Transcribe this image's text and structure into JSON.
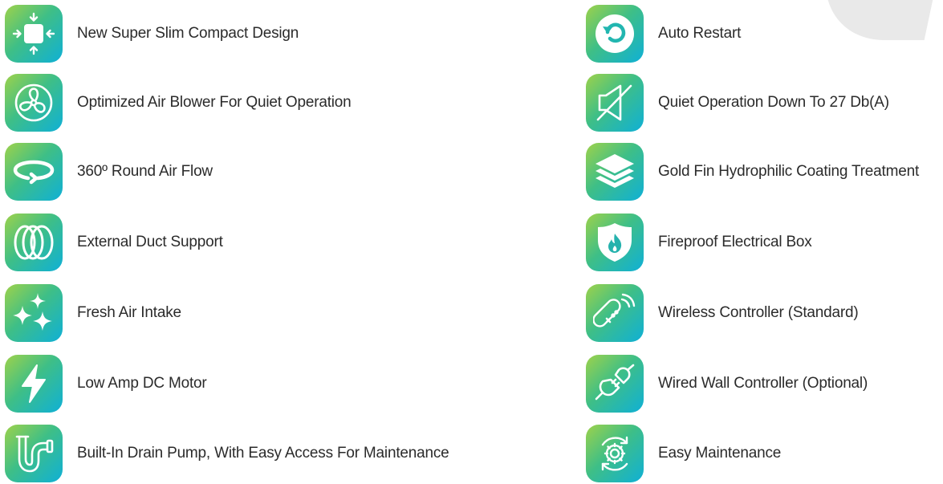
{
  "features_left": [
    {
      "icon": "compact-design-icon",
      "label": "New Super Slim Compact Design"
    },
    {
      "icon": "fan-blower-icon",
      "label": "Optimized Air Blower For Quiet Operation"
    },
    {
      "icon": "round-air-flow-icon",
      "label": "360º Round Air Flow"
    },
    {
      "icon": "duct-rings-icon",
      "label": "External Duct Support"
    },
    {
      "icon": "sparkles-icon",
      "label": "Fresh Air Intake"
    },
    {
      "icon": "lightning-bolt-icon",
      "label": "Low Amp DC Motor"
    },
    {
      "icon": "drain-pipe-icon",
      "label": "Built-In Drain Pump, With Easy Access For Maintenance"
    }
  ],
  "features_right": [
    {
      "icon": "auto-restart-icon",
      "label": "Auto Restart"
    },
    {
      "icon": "mute-speaker-icon",
      "label": "Quiet Operation Down To 27 Db(A)"
    },
    {
      "icon": "layers-icon",
      "label": "Gold Fin Hydrophilic Coating Treatment"
    },
    {
      "icon": "fire-shield-icon",
      "label": "Fireproof Electrical Box"
    },
    {
      "icon": "wireless-remote-icon",
      "label": "Wireless Controller (Standard)"
    },
    {
      "icon": "plug-icon",
      "label": "Wired Wall Controller (Optional)"
    },
    {
      "icon": "gear-maintenance-icon",
      "label": "Easy Maintenance"
    }
  ],
  "colors": {
    "tile_gradient_start": "#9ed24a",
    "tile_gradient_mid": "#3fbf86",
    "tile_gradient_end": "#0fb0d6",
    "icon_color": "#ffffff",
    "text_color": "#2b2b2b",
    "background": "#ffffff"
  }
}
